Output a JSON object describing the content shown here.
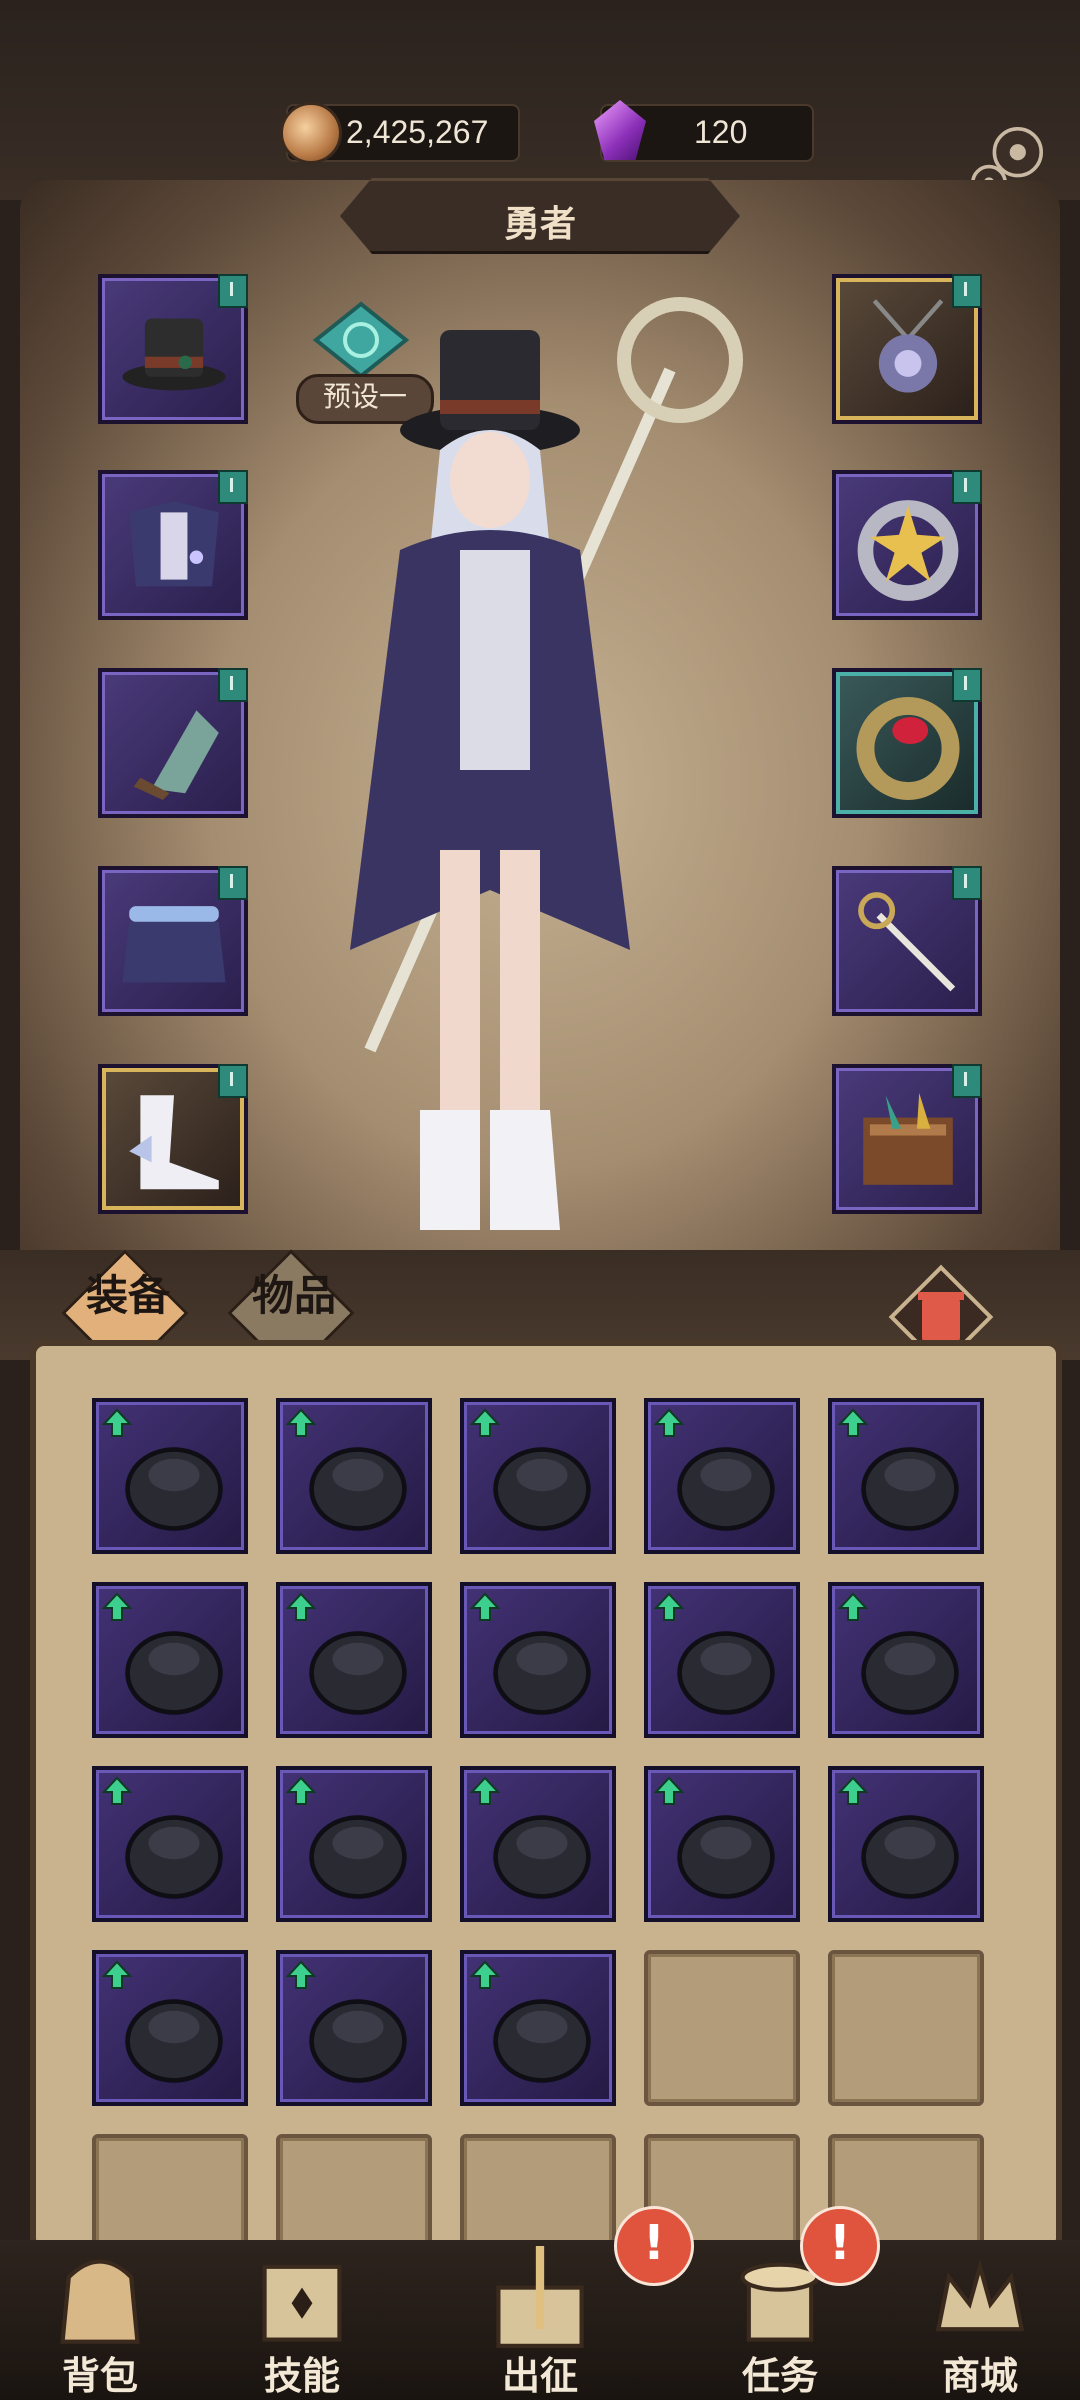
{
  "currency": {
    "coins": "2,425,267",
    "gems": "120"
  },
  "header": {
    "title": "勇者"
  },
  "preset": {
    "label": "预设一"
  },
  "colors": {
    "accent_purple": "#6a58b8",
    "upgrade_green": "#3ccf8e",
    "alert_red": "#e0533c",
    "gold_frame": "#d8b45a"
  },
  "equipment": {
    "left": [
      {
        "name": "hat",
        "icon": "top-hat-icon",
        "frame": "purple"
      },
      {
        "name": "armor",
        "icon": "cape-armor-icon",
        "frame": "purple"
      },
      {
        "name": "gloves",
        "icon": "gauntlet-icon",
        "frame": "purple"
      },
      {
        "name": "belt",
        "icon": "skirt-belt-icon",
        "frame": "purple"
      },
      {
        "name": "boots",
        "icon": "winged-boots-icon",
        "frame": "gold"
      }
    ],
    "right": [
      {
        "name": "amulet",
        "icon": "amulet-icon",
        "frame": "gold"
      },
      {
        "name": "ring1",
        "icon": "star-ring-icon",
        "frame": "purple"
      },
      {
        "name": "ring2",
        "icon": "ruby-ring-icon",
        "frame": "teal"
      },
      {
        "name": "weapon",
        "icon": "staff-icon",
        "frame": "purple"
      },
      {
        "name": "offhand",
        "icon": "spellbook-icon",
        "frame": "purple"
      }
    ]
  },
  "tabs": {
    "equipment": "装备",
    "items": "物品"
  },
  "inventory": [
    {
      "icon": "grey-bracer-icon",
      "upgrade": true
    },
    {
      "icon": "grey-bracer-icon",
      "upgrade": true
    },
    {
      "icon": "witch-hat-icon",
      "upgrade": true
    },
    {
      "icon": "pendant-icon",
      "upgrade": true
    },
    {
      "icon": "top-hat-icon",
      "upgrade": true
    },
    {
      "icon": "claw-glove-icon",
      "upgrade": true
    },
    {
      "icon": "dark-glove-icon",
      "upgrade": true
    },
    {
      "icon": "dark-ring-icon",
      "upgrade": true
    },
    {
      "icon": "wolf-mask-icon",
      "upgrade": true
    },
    {
      "icon": "dark-hood-icon",
      "upgrade": true
    },
    {
      "icon": "witch-hat-icon",
      "upgrade": true
    },
    {
      "icon": "skull-hat-icon",
      "upgrade": true
    },
    {
      "icon": "wand-icon",
      "upgrade": true
    },
    {
      "icon": "dark-glove-icon",
      "upgrade": true
    },
    {
      "icon": "jade-amulet-icon",
      "upgrade": true
    },
    {
      "icon": "dark-ring-icon",
      "upgrade": true
    },
    {
      "icon": "grey-robe-icon",
      "upgrade": true
    },
    {
      "icon": "dark-ring-icon",
      "upgrade": true
    },
    {
      "icon": "empty",
      "upgrade": false
    },
    {
      "icon": "empty",
      "upgrade": false
    },
    {
      "icon": "empty",
      "upgrade": false
    },
    {
      "icon": "empty",
      "upgrade": false
    },
    {
      "icon": "empty",
      "upgrade": false
    },
    {
      "icon": "empty",
      "upgrade": false
    },
    {
      "icon": "empty",
      "upgrade": false
    }
  ],
  "nav": {
    "backpack": "背包",
    "skills": "技能",
    "expedition": "出征",
    "quests": "任务",
    "shop": "商城",
    "alert_mark": "!"
  }
}
